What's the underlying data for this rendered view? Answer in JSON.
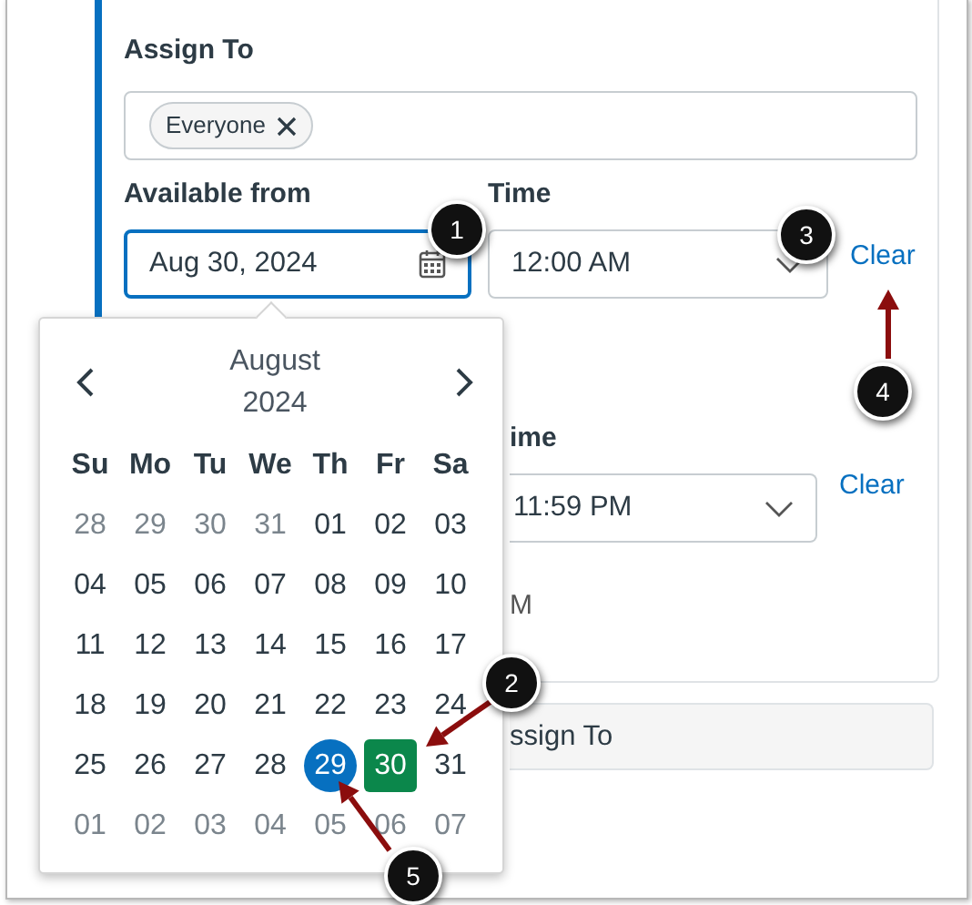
{
  "assign_to": {
    "label": "Assign To",
    "tags": [
      {
        "label": "Everyone"
      }
    ]
  },
  "available_from": {
    "label": "Available from",
    "value": "Aug 30, 2024",
    "focused": true
  },
  "time": {
    "label": "Time",
    "value": "12:00 AM",
    "clear": "Clear"
  },
  "second_time": {
    "label": "ime",
    "value": "11:59 PM",
    "clear": "Clear"
  },
  "partial_text": "M",
  "assign_button": "ssign To",
  "calendar": {
    "month": "August",
    "year": "2024",
    "weekdays": [
      "Su",
      "Mo",
      "Tu",
      "We",
      "Th",
      "Fr",
      "Sa"
    ],
    "weeks": [
      [
        {
          "day": "28",
          "outside": true,
          "today": false,
          "selected": false
        },
        {
          "day": "29",
          "outside": true,
          "today": false,
          "selected": false
        },
        {
          "day": "30",
          "outside": true,
          "today": false,
          "selected": false
        },
        {
          "day": "31",
          "outside": true,
          "today": false,
          "selected": false
        },
        {
          "day": "01",
          "outside": false,
          "today": false,
          "selected": false
        },
        {
          "day": "02",
          "outside": false,
          "today": false,
          "selected": false
        },
        {
          "day": "03",
          "outside": false,
          "today": false,
          "selected": false
        }
      ],
      [
        {
          "day": "04",
          "outside": false,
          "today": false,
          "selected": false
        },
        {
          "day": "05",
          "outside": false,
          "today": false,
          "selected": false
        },
        {
          "day": "06",
          "outside": false,
          "today": false,
          "selected": false
        },
        {
          "day": "07",
          "outside": false,
          "today": false,
          "selected": false
        },
        {
          "day": "08",
          "outside": false,
          "today": false,
          "selected": false
        },
        {
          "day": "09",
          "outside": false,
          "today": false,
          "selected": false
        },
        {
          "day": "10",
          "outside": false,
          "today": false,
          "selected": false
        }
      ],
      [
        {
          "day": "11",
          "outside": false,
          "today": false,
          "selected": false
        },
        {
          "day": "12",
          "outside": false,
          "today": false,
          "selected": false
        },
        {
          "day": "13",
          "outside": false,
          "today": false,
          "selected": false
        },
        {
          "day": "14",
          "outside": false,
          "today": false,
          "selected": false
        },
        {
          "day": "15",
          "outside": false,
          "today": false,
          "selected": false
        },
        {
          "day": "16",
          "outside": false,
          "today": false,
          "selected": false
        },
        {
          "day": "17",
          "outside": false,
          "today": false,
          "selected": false
        }
      ],
      [
        {
          "day": "18",
          "outside": false,
          "today": false,
          "selected": false
        },
        {
          "day": "19",
          "outside": false,
          "today": false,
          "selected": false
        },
        {
          "day": "20",
          "outside": false,
          "today": false,
          "selected": false
        },
        {
          "day": "21",
          "outside": false,
          "today": false,
          "selected": false
        },
        {
          "day": "22",
          "outside": false,
          "today": false,
          "selected": false
        },
        {
          "day": "23",
          "outside": false,
          "today": false,
          "selected": false
        },
        {
          "day": "24",
          "outside": false,
          "today": false,
          "selected": false
        }
      ],
      [
        {
          "day": "25",
          "outside": false,
          "today": false,
          "selected": false
        },
        {
          "day": "26",
          "outside": false,
          "today": false,
          "selected": false
        },
        {
          "day": "27",
          "outside": false,
          "today": false,
          "selected": false
        },
        {
          "day": "28",
          "outside": false,
          "today": false,
          "selected": false
        },
        {
          "day": "29",
          "outside": false,
          "today": true,
          "selected": false
        },
        {
          "day": "30",
          "outside": false,
          "today": false,
          "selected": true
        },
        {
          "day": "31",
          "outside": false,
          "today": false,
          "selected": false
        }
      ],
      [
        {
          "day": "01",
          "outside": true,
          "today": false,
          "selected": false
        },
        {
          "day": "02",
          "outside": true,
          "today": false,
          "selected": false
        },
        {
          "day": "03",
          "outside": true,
          "today": false,
          "selected": false
        },
        {
          "day": "04",
          "outside": true,
          "today": false,
          "selected": false
        },
        {
          "day": "05",
          "outside": true,
          "today": false,
          "selected": false
        },
        {
          "day": "06",
          "outside": true,
          "today": false,
          "selected": false
        },
        {
          "day": "07",
          "outside": true,
          "today": false,
          "selected": false
        }
      ]
    ]
  },
  "callouts": [
    {
      "number": "1",
      "arrow": false
    },
    {
      "number": "2",
      "arrow": true
    },
    {
      "number": "3",
      "arrow": false
    },
    {
      "number": "4",
      "arrow": true
    },
    {
      "number": "5",
      "arrow": true
    }
  ]
}
